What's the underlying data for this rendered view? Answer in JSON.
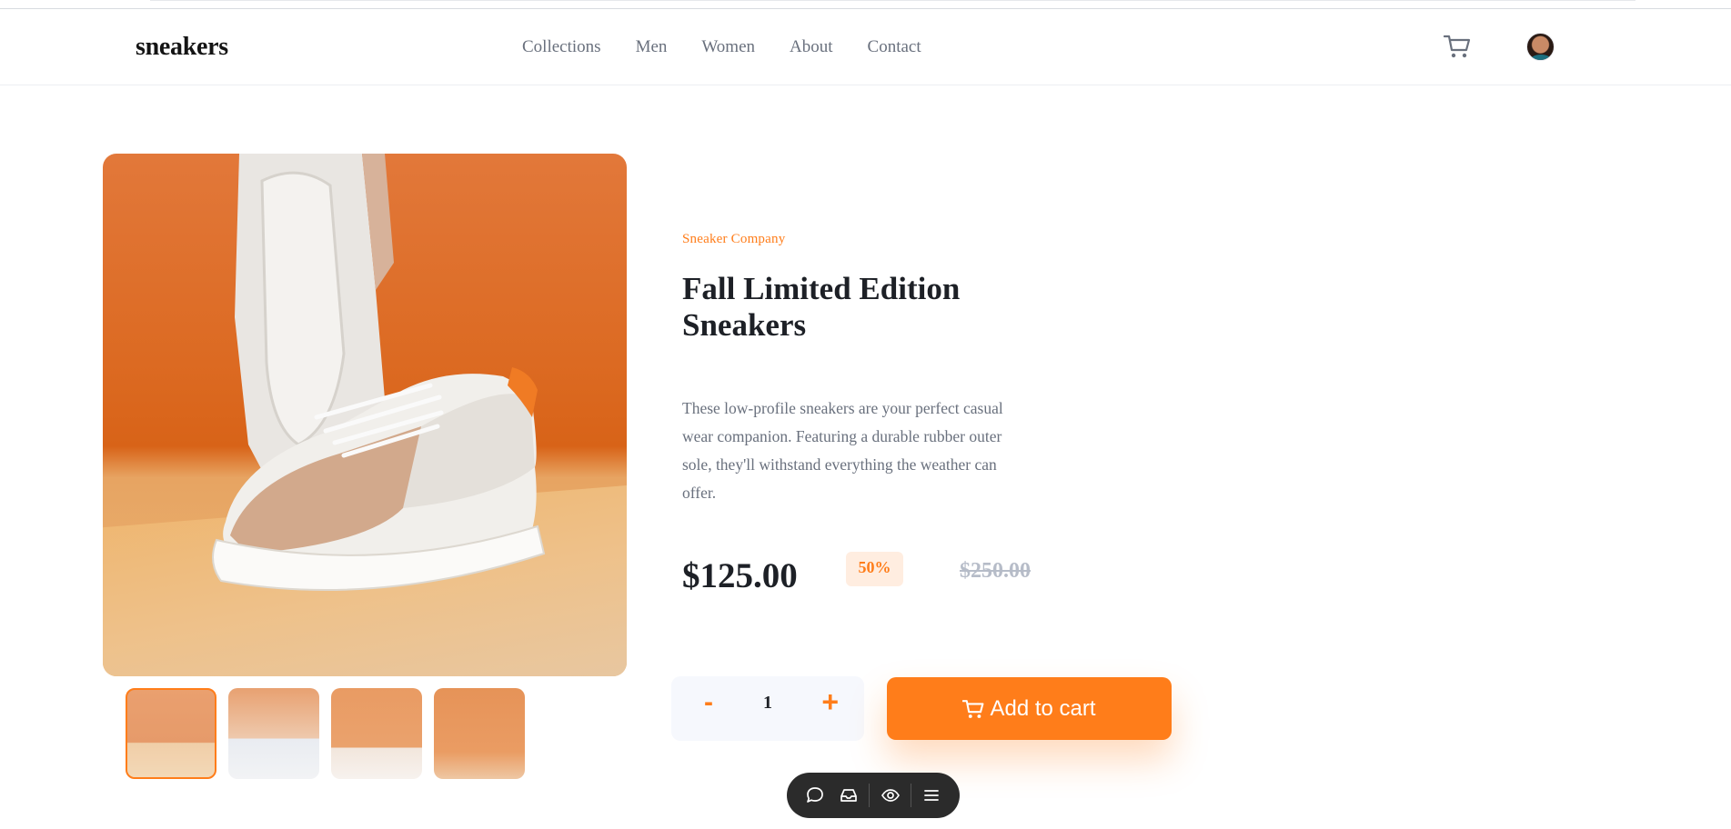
{
  "header": {
    "logo": "sneakers",
    "nav": [
      "Collections",
      "Men",
      "Women",
      "About",
      "Contact"
    ]
  },
  "product": {
    "company": "Sneaker Company",
    "title": "Fall Limited Edition Sneakers",
    "description": "These low-profile sneakers are your perfect casual wear companion. Featuring a durable rubber outer sole, they'll withstand everything the weather can offer.",
    "price": "$125.00",
    "discount": "50%",
    "old_price": "$250.00"
  },
  "cart": {
    "minus": "-",
    "quantity": "1",
    "plus": "+",
    "add_label": "Add to cart"
  },
  "gallery": {
    "thumbnail_count": 4,
    "active_thumbnail": 1
  },
  "toolbar": {
    "icons": [
      "chat-icon",
      "inbox-icon",
      "eye-icon",
      "menu-icon"
    ]
  },
  "colors": {
    "accent": "#ff7d1a",
    "accent_light": "#ffede0",
    "text_dark": "#1d2026",
    "text_muted": "#69707d"
  }
}
